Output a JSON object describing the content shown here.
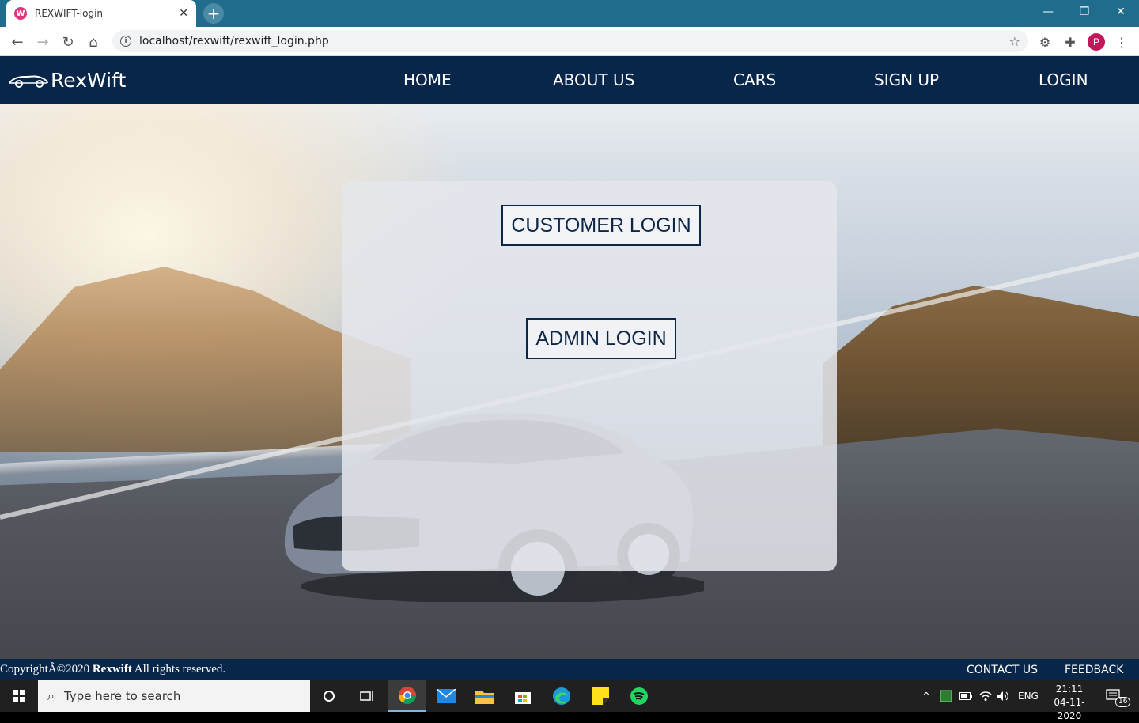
{
  "browser": {
    "tab_title": "REXWIFT-login",
    "tab_favicon": "W",
    "new_tab_label": "+",
    "url": "localhost/rexwift/rexwift_login.php",
    "profile_initial": "P"
  },
  "site": {
    "brand": "RexWift",
    "nav": [
      {
        "label": "HOME"
      },
      {
        "label": "ABOUT US"
      },
      {
        "label": "CARS"
      },
      {
        "label": "SIGN UP"
      },
      {
        "label": "LOGIN"
      }
    ]
  },
  "login_panel": {
    "customer_login": "CUSTOMER LOGIN",
    "admin_login": "ADMIN LOGIN"
  },
  "footer": {
    "copyright_prefix": "CopyrightÂ©2020 ",
    "brand": "Rexwift",
    "copyright_suffix": " All rights reserved.",
    "contact": "CONTACT US",
    "feedback": "FEEDBACK"
  },
  "taskbar": {
    "search_placeholder": "Type here to search",
    "language": "ENG",
    "time": "21:11",
    "date": "04-11-2020",
    "notification_count": "16"
  },
  "colors": {
    "nav_bg": "#08264a",
    "button_border": "#0e2747",
    "tab_strip": "#1f6c8c"
  }
}
